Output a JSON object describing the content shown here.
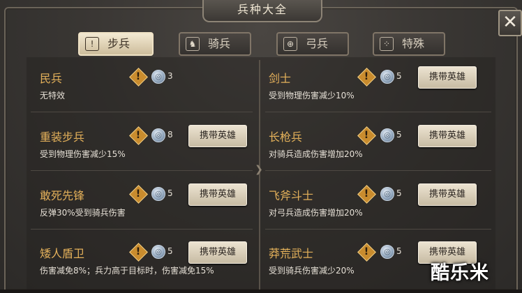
{
  "window": {
    "title": "兵种大全",
    "close_glyph": "✕"
  },
  "tabs": [
    {
      "label": "步兵",
      "icon": "warning-icon",
      "glyph": "!",
      "active": true
    },
    {
      "label": "骑兵",
      "icon": "horse-icon",
      "glyph": "♞",
      "active": false
    },
    {
      "label": "弓兵",
      "icon": "bow-icon",
      "glyph": "⊕",
      "active": false
    },
    {
      "label": "特殊",
      "icon": "dice-icon",
      "glyph": "⁘",
      "active": false
    }
  ],
  "units": [
    {
      "name": "民兵",
      "desc": "无特效",
      "count": "3",
      "carry_label": ""
    },
    {
      "name": "重装步兵",
      "desc": "受到物理伤害减少15%",
      "count": "8",
      "carry_label": "携带英雄"
    },
    {
      "name": "敢死先锋",
      "desc": "反弹30%受到骑兵伤害",
      "count": "5",
      "carry_label": "携带英雄"
    },
    {
      "name": "矮人盾卫",
      "desc": "伤害减免8%；兵力高于目标时，伤害减免15%",
      "count": "5",
      "carry_label": "携带英雄"
    },
    {
      "name": "剑士",
      "desc": "受到物理伤害减少10%",
      "count": "5",
      "carry_label": "携带英雄"
    },
    {
      "name": "长枪兵",
      "desc": "对骑兵造成伤害增加20%",
      "count": "5",
      "carry_label": "携带英雄"
    },
    {
      "name": "飞斧斗士",
      "desc": "对弓兵造成伤害增加20%",
      "count": "5",
      "carry_label": "携带英雄"
    },
    {
      "name": "莽荒武士",
      "desc": "受到骑兵伤害减少20%",
      "count": "5",
      "carry_label": "携带英雄"
    }
  ],
  "glyphs": {
    "warn": "!",
    "coin": "◎"
  },
  "watermark": "酷乐米",
  "colors": {
    "unit_name": "#e3b05a",
    "tab_active_bg": "#e8dcc2",
    "button_bg": "#e4dac6"
  }
}
